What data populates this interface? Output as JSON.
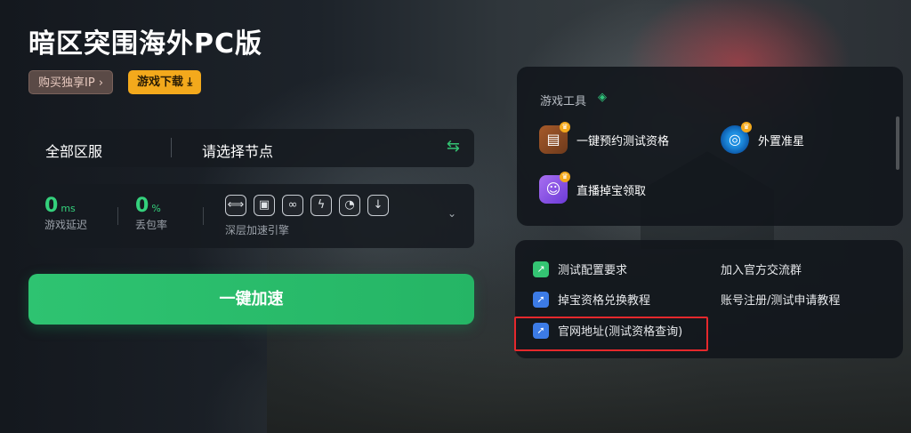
{
  "app": {
    "title": "暗区突围海外PC版",
    "badge_ip": "购买独享IP",
    "badge_download": "游戏下载"
  },
  "node": {
    "region": "全部区服",
    "selector_placeholder": "请选择节点",
    "swap_icon": "swap-arrows-icon"
  },
  "stats": {
    "latency_value": "0",
    "latency_unit": "ms",
    "latency_label": "游戏延迟",
    "loss_value": "0",
    "loss_unit": "%",
    "loss_label": "丢包率",
    "engine_label": "深层加速引擎",
    "engine_icons": [
      "link-icon",
      "screen-icon",
      "network-icon",
      "bolt-icon",
      "gauge-icon",
      "download-icon"
    ]
  },
  "boost": {
    "label": "一键加速"
  },
  "tools": {
    "title": "游戏工具",
    "items": [
      {
        "label": "一键预约测试资格",
        "icon": "reserve-icon"
      },
      {
        "label": "外置准星",
        "icon": "crosshair-icon"
      },
      {
        "label": "直播掉宝领取",
        "icon": "live-drop-icon"
      }
    ]
  },
  "links": {
    "items": [
      {
        "label": "测试配置要求",
        "icon": "link-icon"
      },
      {
        "label": "加入官方交流群",
        "icon": ""
      },
      {
        "label": "掉宝资格兑换教程",
        "icon": "cursor-icon"
      },
      {
        "label": "账号注册/测试申请教程",
        "icon": ""
      },
      {
        "label": "官网地址(测试资格查询)",
        "icon": "cursor-icon"
      }
    ]
  },
  "colors": {
    "accent_green": "#2ec371",
    "badge_orange": "#f3a91c",
    "highlight_red": "#e5282c"
  }
}
